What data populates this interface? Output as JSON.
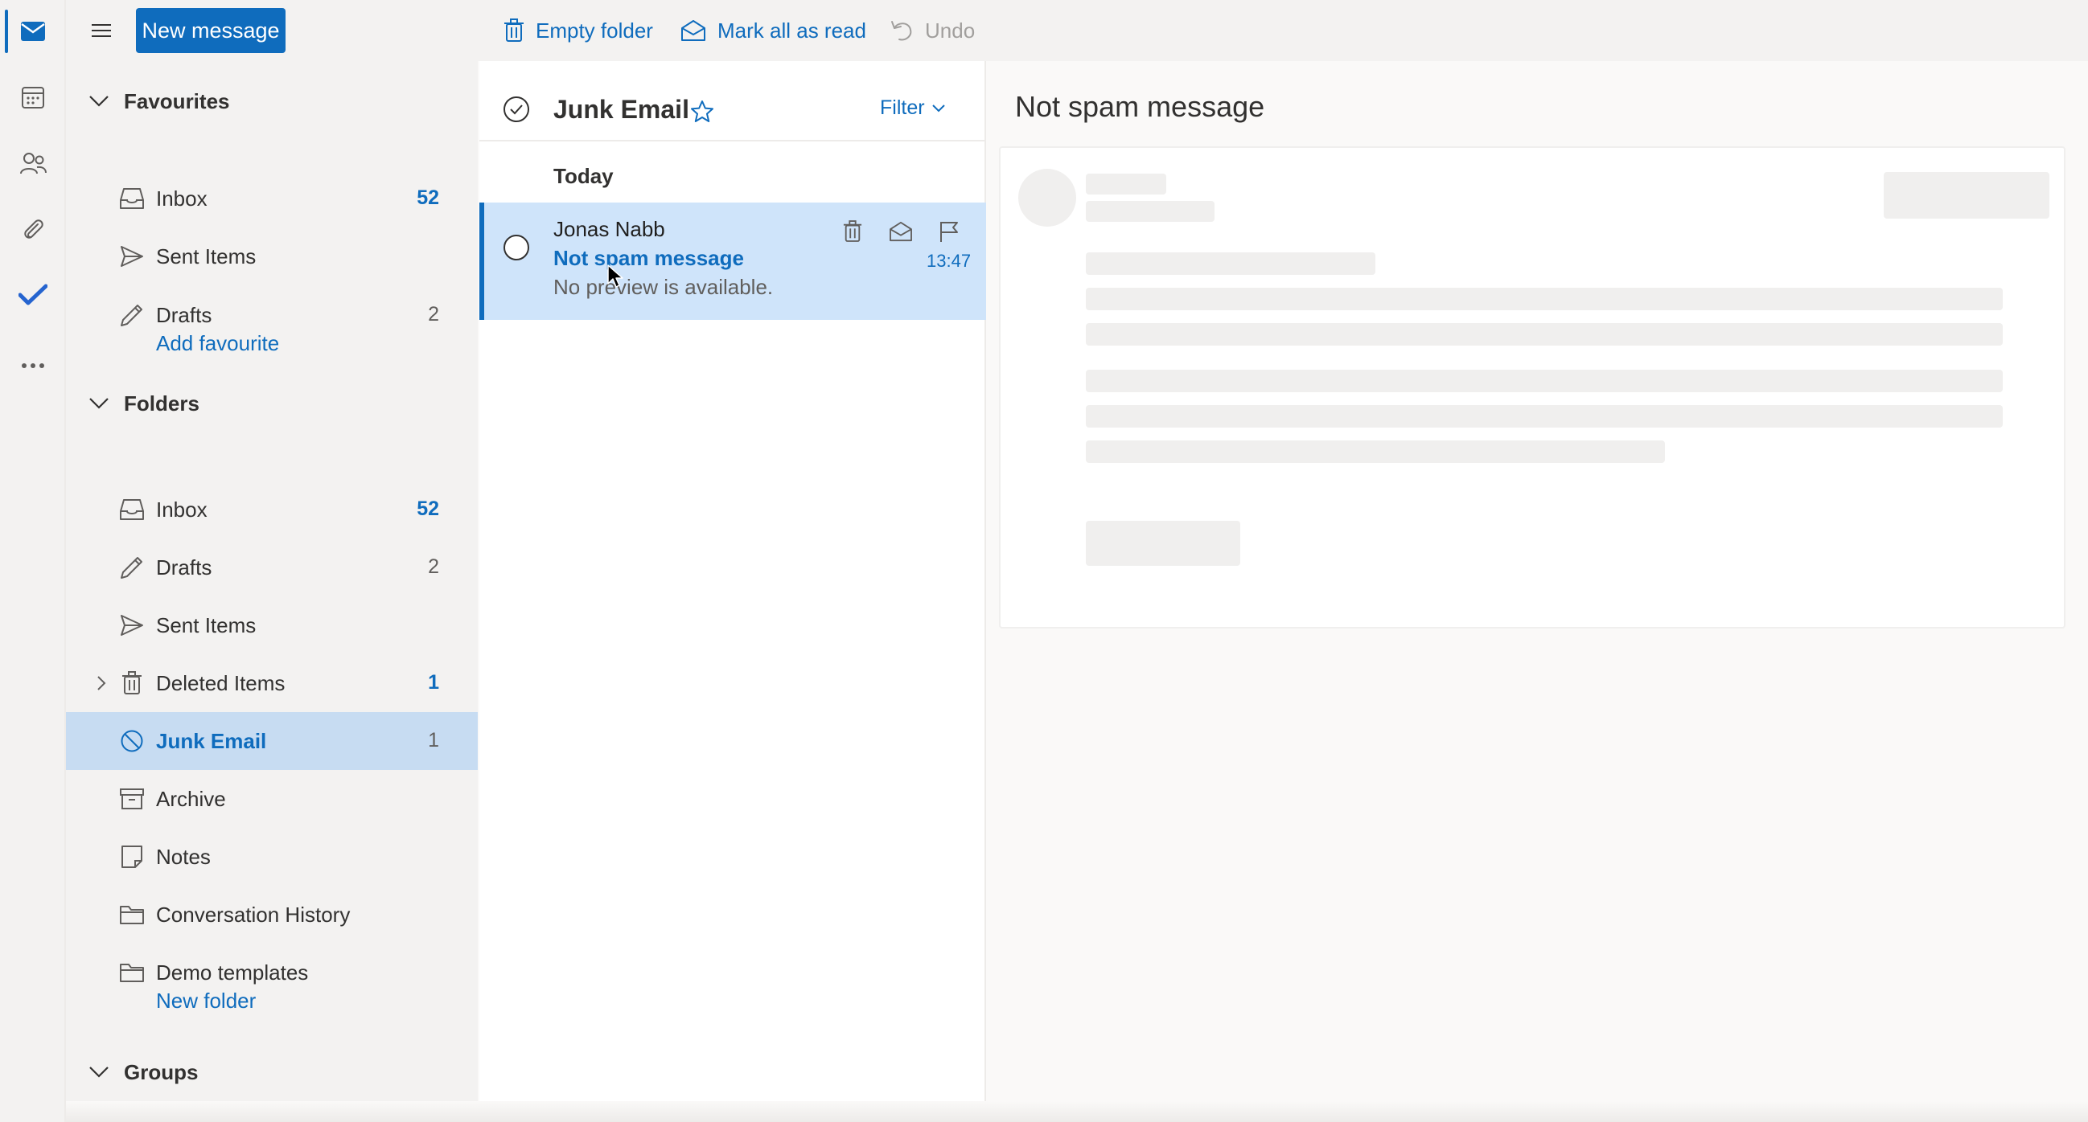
{
  "rail": {
    "items": [
      {
        "name": "mail-icon",
        "active": true
      },
      {
        "name": "calendar-icon",
        "active": false
      },
      {
        "name": "people-icon",
        "active": false
      },
      {
        "name": "paperclip-icon",
        "active": false
      },
      {
        "name": "todo-check-icon",
        "active": false
      },
      {
        "name": "more-icon",
        "active": false
      }
    ]
  },
  "toolbar": {
    "new_message_label": "New message",
    "empty_folder_label": "Empty folder",
    "mark_all_read_label": "Mark all as read",
    "undo_label": "Undo"
  },
  "folders": {
    "favourites_label": "Favourites",
    "favourites": [
      {
        "label": "Inbox",
        "count": "52",
        "icon": "inbox-icon"
      },
      {
        "label": "Sent Items",
        "count": "",
        "icon": "send-icon"
      },
      {
        "label": "Drafts",
        "count": "2",
        "icon": "pencil-icon"
      }
    ],
    "add_favourite_label": "Add favourite",
    "folders_label": "Folders",
    "items": [
      {
        "label": "Inbox",
        "count": "52",
        "icon": "inbox-icon"
      },
      {
        "label": "Drafts",
        "count": "2",
        "icon": "pencil-icon"
      },
      {
        "label": "Sent Items",
        "count": "",
        "icon": "send-icon"
      },
      {
        "label": "Deleted Items",
        "count": "1",
        "icon": "trash-icon"
      },
      {
        "label": "Junk Email",
        "count": "1",
        "icon": "block-icon"
      },
      {
        "label": "Archive",
        "count": "",
        "icon": "archive-icon"
      },
      {
        "label": "Notes",
        "count": "",
        "icon": "note-icon"
      },
      {
        "label": "Conversation History",
        "count": "",
        "icon": "folder-icon"
      },
      {
        "label": "Demo templates",
        "count": "",
        "icon": "folder-icon"
      }
    ],
    "new_folder_label": "New folder",
    "groups_label": "Groups"
  },
  "message_list": {
    "title": "Junk Email",
    "filter_label": "Filter",
    "group_label": "Today",
    "messages": [
      {
        "sender": "Jonas Nabb",
        "subject": "Not spam message",
        "preview": "No preview is available.",
        "time": "13:47"
      }
    ]
  },
  "reading_pane": {
    "subject": "Not spam message"
  },
  "colors": {
    "accent": "#0f6cbd",
    "selected_folder": "#c7dcf2",
    "selected_message": "#cfe4fa",
    "pane_bg": "#f3f2f1"
  }
}
